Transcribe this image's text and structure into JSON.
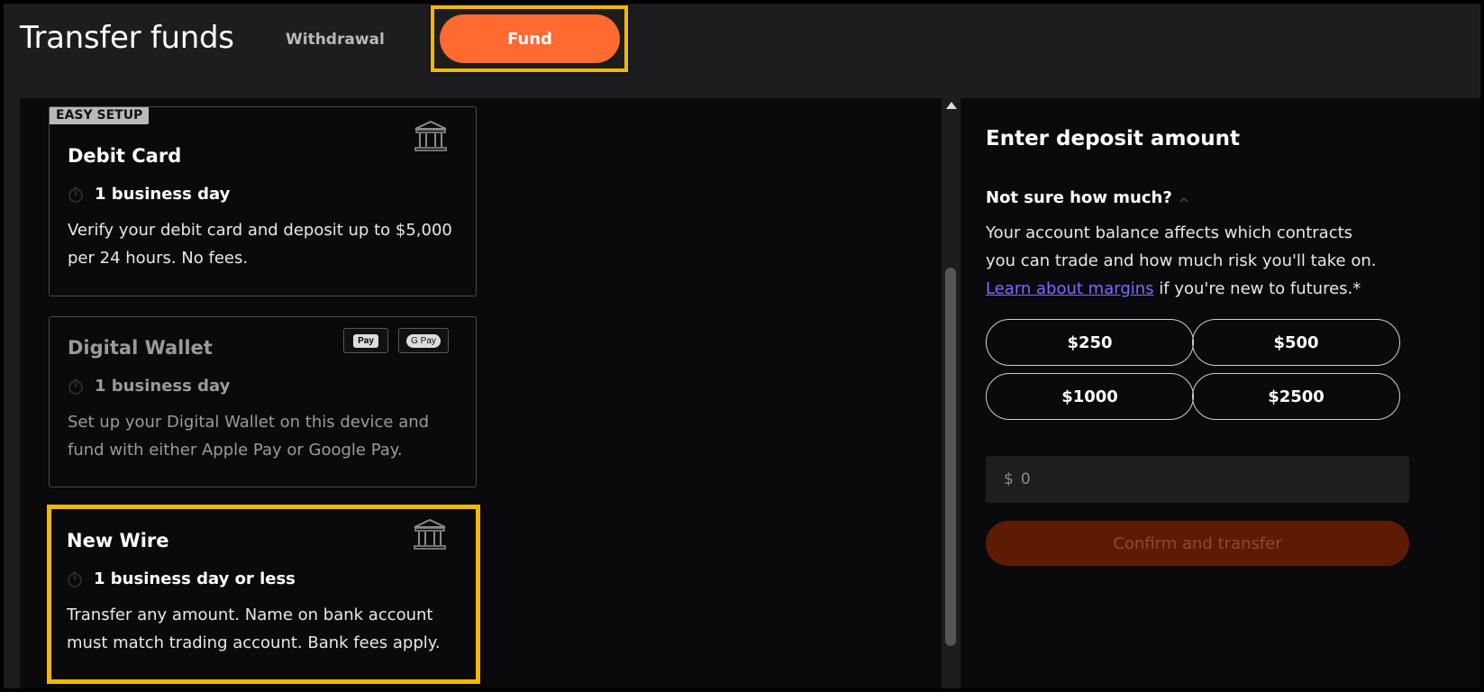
{
  "header": {
    "title": "Transfer funds",
    "tabs": {
      "withdrawal": "Withdrawal",
      "fund": "Fund"
    }
  },
  "methods": [
    {
      "badge": "EASY SETUP",
      "title": "Debit Card",
      "time": "1 business day",
      "description": "Verify your debit card and deposit up to $5,000 per 24 hours. No fees.",
      "icon": "bank-icon"
    },
    {
      "title": "Digital Wallet",
      "time": "1 business day",
      "description": "Set up your Digital Wallet on this device and fund with either Apple Pay or Google Pay.",
      "badges": [
        "Pay",
        "G Pay"
      ],
      "icons": [
        "apple-pay-icon",
        "google-pay-icon"
      ]
    },
    {
      "title": "New Wire",
      "time": "1 business day or less",
      "description": "Transfer any amount. Name on bank account must match trading account. Bank fees apply.",
      "icon": "bank-icon"
    }
  ],
  "deposit": {
    "title": "Enter deposit amount",
    "question": "Not sure how much?",
    "info_pre": "Your account balance affects which contracts you can trade and how much risk you'll take on. ",
    "info_link": "Learn about margins",
    "info_post": " if you're new to futures.*",
    "amounts": [
      "$250",
      "$500",
      "$1000",
      "$2500"
    ],
    "currency_symbol": "$",
    "input_placeholder": "0",
    "confirm_label": "Confirm and transfer"
  },
  "colors": {
    "accent": "#ff6a30",
    "highlight": "#f5b800",
    "link": "#7a6cff",
    "confirm_disabled_bg": "#5d1b06"
  }
}
